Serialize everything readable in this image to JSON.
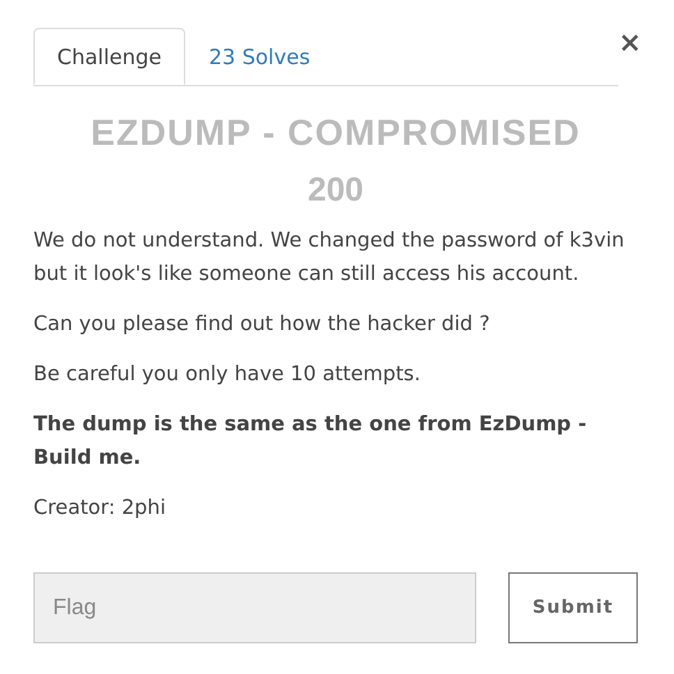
{
  "tabs": [
    {
      "label": "Challenge",
      "selected": true
    },
    {
      "label": "23 Solves",
      "selected": false
    }
  ],
  "close": "×",
  "challenge": {
    "title": "EZDUMP - COMPROMISED",
    "points": "200"
  },
  "description": [
    {
      "text": "We do not understand. We changed the password of k3vin but it look's like someone can still access his account.",
      "bold": false
    },
    {
      "text": "Can you please find out how the hacker did ?",
      "bold": false
    },
    {
      "text": "Be careful you only have 10 attempts.",
      "bold": false
    },
    {
      "text": "The dump is the same as the one from EzDump - Build me.",
      "bold": true
    },
    {
      "text": "Creator: 2phi",
      "bold": false
    }
  ],
  "flag_field": {
    "placeholder": "Flag"
  },
  "submit": "Submit"
}
